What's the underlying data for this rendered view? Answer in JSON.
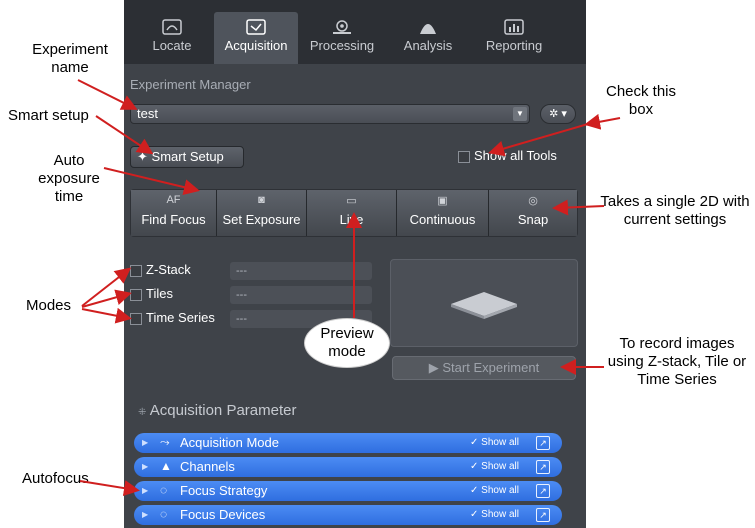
{
  "tabs": [
    {
      "label": "Locate",
      "icon": "locate-icon",
      "active": false
    },
    {
      "label": "Acquisition",
      "icon": "acquisition-icon",
      "active": true
    },
    {
      "label": "Processing",
      "icon": "processing-icon",
      "active": false
    },
    {
      "label": "Analysis",
      "icon": "analysis-icon",
      "active": false
    },
    {
      "label": "Reporting",
      "icon": "reporting-icon",
      "active": false
    }
  ],
  "experiment_manager": {
    "title": "Experiment Manager",
    "selected_experiment": "test"
  },
  "smart_setup_label": "Smart Setup",
  "show_all_tools_label": "Show all Tools",
  "toolbar": [
    {
      "label": "Find Focus",
      "icon_text": "AF"
    },
    {
      "label": "Set Exposure",
      "icon": "camera-icon"
    },
    {
      "label": "Live",
      "icon": "live-icon"
    },
    {
      "label": "Continuous",
      "icon": "continuous-icon"
    },
    {
      "label": "Snap",
      "icon": "snap-icon"
    }
  ],
  "modes": [
    {
      "label": "Z-Stack",
      "value": "---"
    },
    {
      "label": "Tiles",
      "value": "---"
    },
    {
      "label": "Time Series",
      "value": "---"
    }
  ],
  "start_experiment_label": "Start Experiment",
  "acquisition_parameter_title": "Acquisition Parameter",
  "parameter_sections": [
    {
      "label": "Acquisition Mode",
      "show_all": "Show all"
    },
    {
      "label": "Channels",
      "show_all": "Show all"
    },
    {
      "label": "Focus Strategy",
      "show_all": "Show all"
    },
    {
      "label": "Focus Devices",
      "show_all": "Show all"
    }
  ],
  "annotations": {
    "experiment_name": "Experiment name",
    "smart_setup": "Smart setup",
    "auto_exposure": "Auto exposure time",
    "modes": "Modes",
    "autofocus": "Autofocus",
    "check_box": "Check this box",
    "snap": "Takes a single 2D with current settings",
    "record": "To record images using Z-stack, Tile or Time Series",
    "preview": "Preview mode"
  },
  "colors": {
    "panel": "#3f4349",
    "accent_blue": "#2f6ee0",
    "arrow": "#d01f1f"
  }
}
